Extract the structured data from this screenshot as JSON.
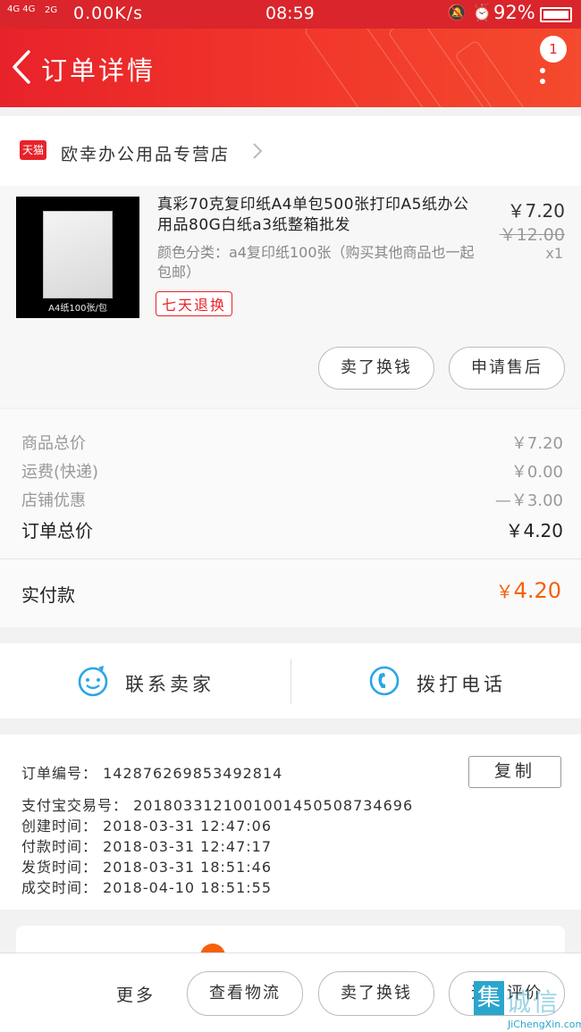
{
  "status_bar": {
    "signal_1": "4G 4G",
    "signal_2": "2G",
    "net_speed": "0.00K/s",
    "time": "08:59",
    "battery": "92%"
  },
  "header": {
    "title": "订单详情",
    "notification_count": "1"
  },
  "store": {
    "badge": "天猫",
    "name": "欧幸办公用品专营店"
  },
  "product": {
    "title": "真彩70克复印纸A4单包500张打印A5纸办公用品80G白纸a3纸整箱批发",
    "image_caption": "A4纸100张/包",
    "sku": "颜色分类：a4复印纸100张（购买其他商品也一起包邮）",
    "service_tag": "七天退换",
    "price": "￥7.20",
    "original_price": "￥12.00",
    "quantity": "x1",
    "buttons": {
      "sell": "卖了换钱",
      "after_sale": "申请售后"
    }
  },
  "summary": {
    "rows": [
      {
        "label": "商品总价",
        "value": "￥7.20"
      },
      {
        "label": "运费(快递)",
        "value": "￥0.00"
      },
      {
        "label": "店铺优惠",
        "value": "—￥3.00"
      }
    ],
    "total_label": "订单总价",
    "total_value": "￥4.20",
    "paid_label": "实付款",
    "paid_currency": "￥",
    "paid_amount": "4.20"
  },
  "contact": {
    "seller": "联系卖家",
    "call": "拨打电话"
  },
  "order_info": {
    "copy_label": "复制",
    "lines": [
      {
        "label": "订单编号：",
        "value": "142876269853492814"
      },
      {
        "label": "支付宝交易号：",
        "value": "2018033121001001450508734696"
      },
      {
        "label": "创建时间：",
        "value": "2018-03-31 12:47:06"
      },
      {
        "label": "付款时间：",
        "value": "2018-03-31 12:47:17"
      },
      {
        "label": "发货时间：",
        "value": "2018-03-31 18:51:46"
      },
      {
        "label": "成交时间：",
        "value": "2018-04-10 18:51:55"
      }
    ]
  },
  "bottom_bar": {
    "more": "更多",
    "logistics": "查看物流",
    "sell": "卖了换钱",
    "review": "追加评价"
  },
  "watermark": {
    "box": "集",
    "text": "诚信",
    "url": "JiChengXin.com"
  },
  "colors": {
    "brand_red": "#e8222a",
    "price_orange": "#f5600c",
    "contact_blue": "#2aa6e8"
  }
}
